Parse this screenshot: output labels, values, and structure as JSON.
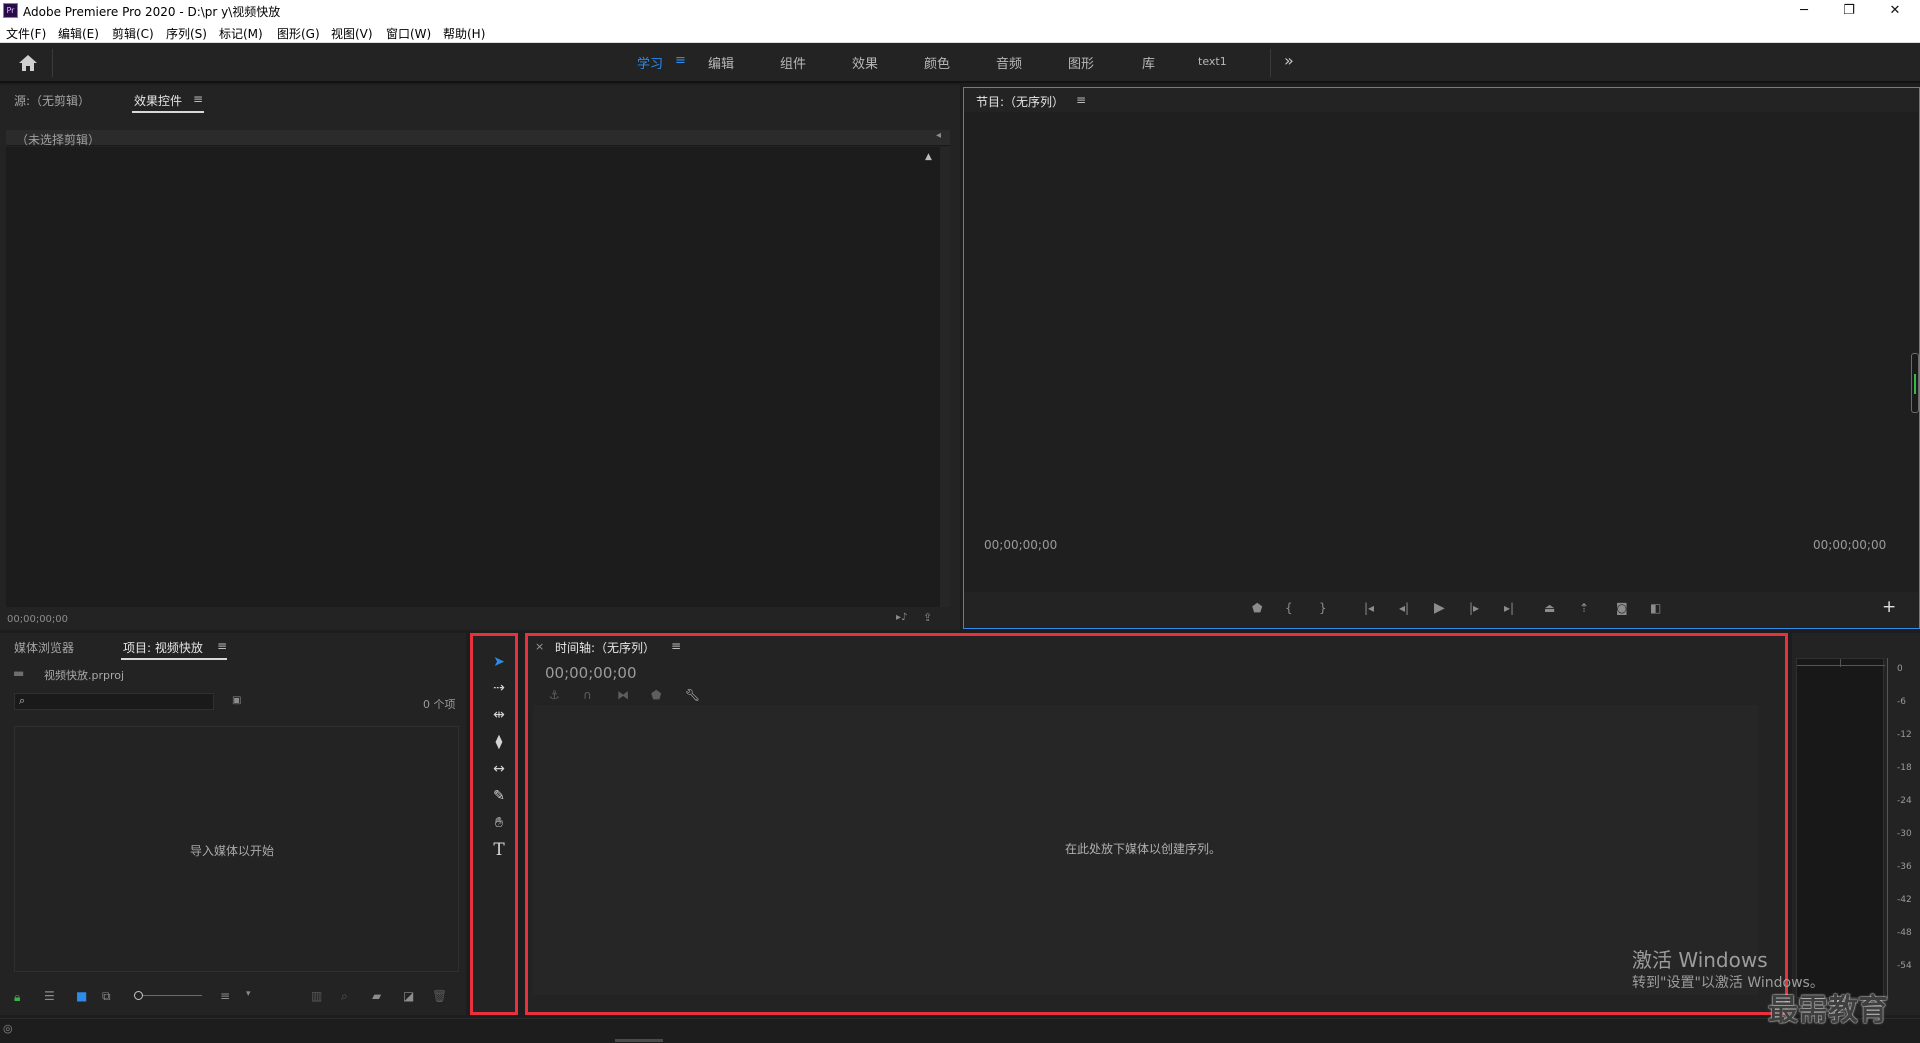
{
  "window": {
    "app_icon": "Pr",
    "title": "Adobe Premiere Pro 2020 - D:\\pr y\\视频快放",
    "controls": [
      "minimize-icon",
      "restore-icon",
      "close-icon"
    ]
  },
  "menu": [
    "文件(F)",
    "编辑(E)",
    "剪辑(C)",
    "序列(S)",
    "标记(M)",
    "图形(G)",
    "视图(V)",
    "窗口(W)",
    "帮助(H)"
  ],
  "workspaces": {
    "items": [
      "学习",
      "编辑",
      "组件",
      "效果",
      "颜色",
      "音频",
      "图形",
      "库",
      "text1"
    ],
    "active": "学习",
    "menu_glyph": "≡",
    "more_glyph": "»"
  },
  "source_panel": {
    "tab_source": "源:（无剪辑）",
    "tab_effects": "效果控件",
    "menu_glyph": "≡",
    "no_clip": "（未选择剪辑）",
    "timecode": "00;00;00;00"
  },
  "program_panel": {
    "tab": "节目:（无序列）",
    "menu_glyph": "≡",
    "timecode_left": "00;00;00;00",
    "timecode_right": "00;00;00;00",
    "add_glyph": "+"
  },
  "project_panel": {
    "tab_media": "媒体浏览器",
    "tab_project": "项目: 视频快放",
    "menu_glyph": "≡",
    "file_name": "视频快放.prproj",
    "item_count": "0 个项",
    "empty_hint": "导入媒体以开始"
  },
  "tools": [
    "selection-tool",
    "track-select-tool",
    "ripple-edit-tool",
    "razor-tool",
    "slip-tool",
    "pen-tool",
    "hand-tool",
    "type-tool"
  ],
  "timeline_panel": {
    "close_glyph": "×",
    "tab": "时间轴:（无序列）",
    "menu_glyph": "≡",
    "timecode": "00;00;00;00",
    "drop_hint": "在此处放下媒体以创建序列。"
  },
  "audio_meter": {
    "ticks": [
      "0",
      "-6",
      "-12",
      "-18",
      "-24",
      "-30",
      "-36",
      "-42",
      "-48",
      "-54"
    ]
  },
  "watermark": {
    "line1": "激活 Windows",
    "line2": "转到\"设置\"以激活 Windows。",
    "brand": "最需教育"
  },
  "colors": {
    "accent": "#2d8ceb",
    "highlight_border": "#e8313c",
    "panel_bg": "#232323"
  }
}
